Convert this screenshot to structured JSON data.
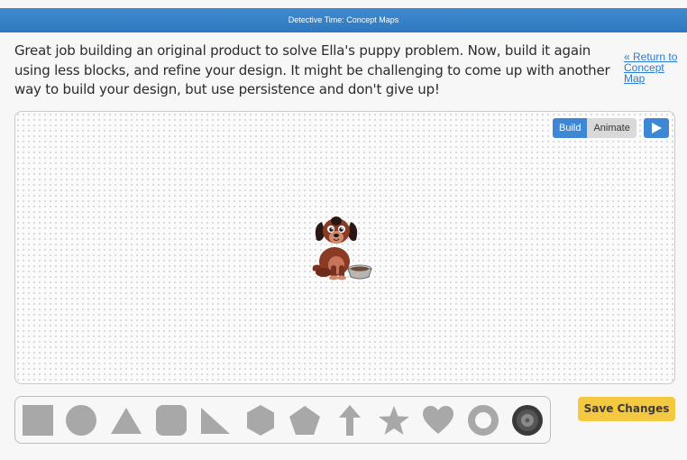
{
  "window": {
    "title": "Detective Time: Concept Maps"
  },
  "instructions": {
    "text": "Great job building an original product to solve Ella's puppy problem. Now, build it again using less blocks, and refine your design. It might be challenging to come up with another way to build your design, but use persistence and don't give up!"
  },
  "return_link": {
    "label": "« Return to Concept Map"
  },
  "canvas": {
    "mode_toggle": {
      "build_label": "Build",
      "animate_label": "Animate",
      "selected": "Build"
    },
    "play_icon": "play-icon",
    "character": "puppy-with-bowl"
  },
  "shapes": [
    "square",
    "circle",
    "triangle",
    "rounded-square",
    "right-triangle",
    "hexagon",
    "pentagon",
    "up-arrow",
    "star",
    "heart",
    "ring",
    "wheel"
  ],
  "save_button": {
    "label": "Save Changes"
  },
  "colors": {
    "title_bar": "#3f8bd0",
    "accent_blue": "#3d87d4",
    "save_yellow": "#f5c842",
    "shape_gray": "#a8a8a8",
    "link_blue": "#2a7bd0"
  }
}
